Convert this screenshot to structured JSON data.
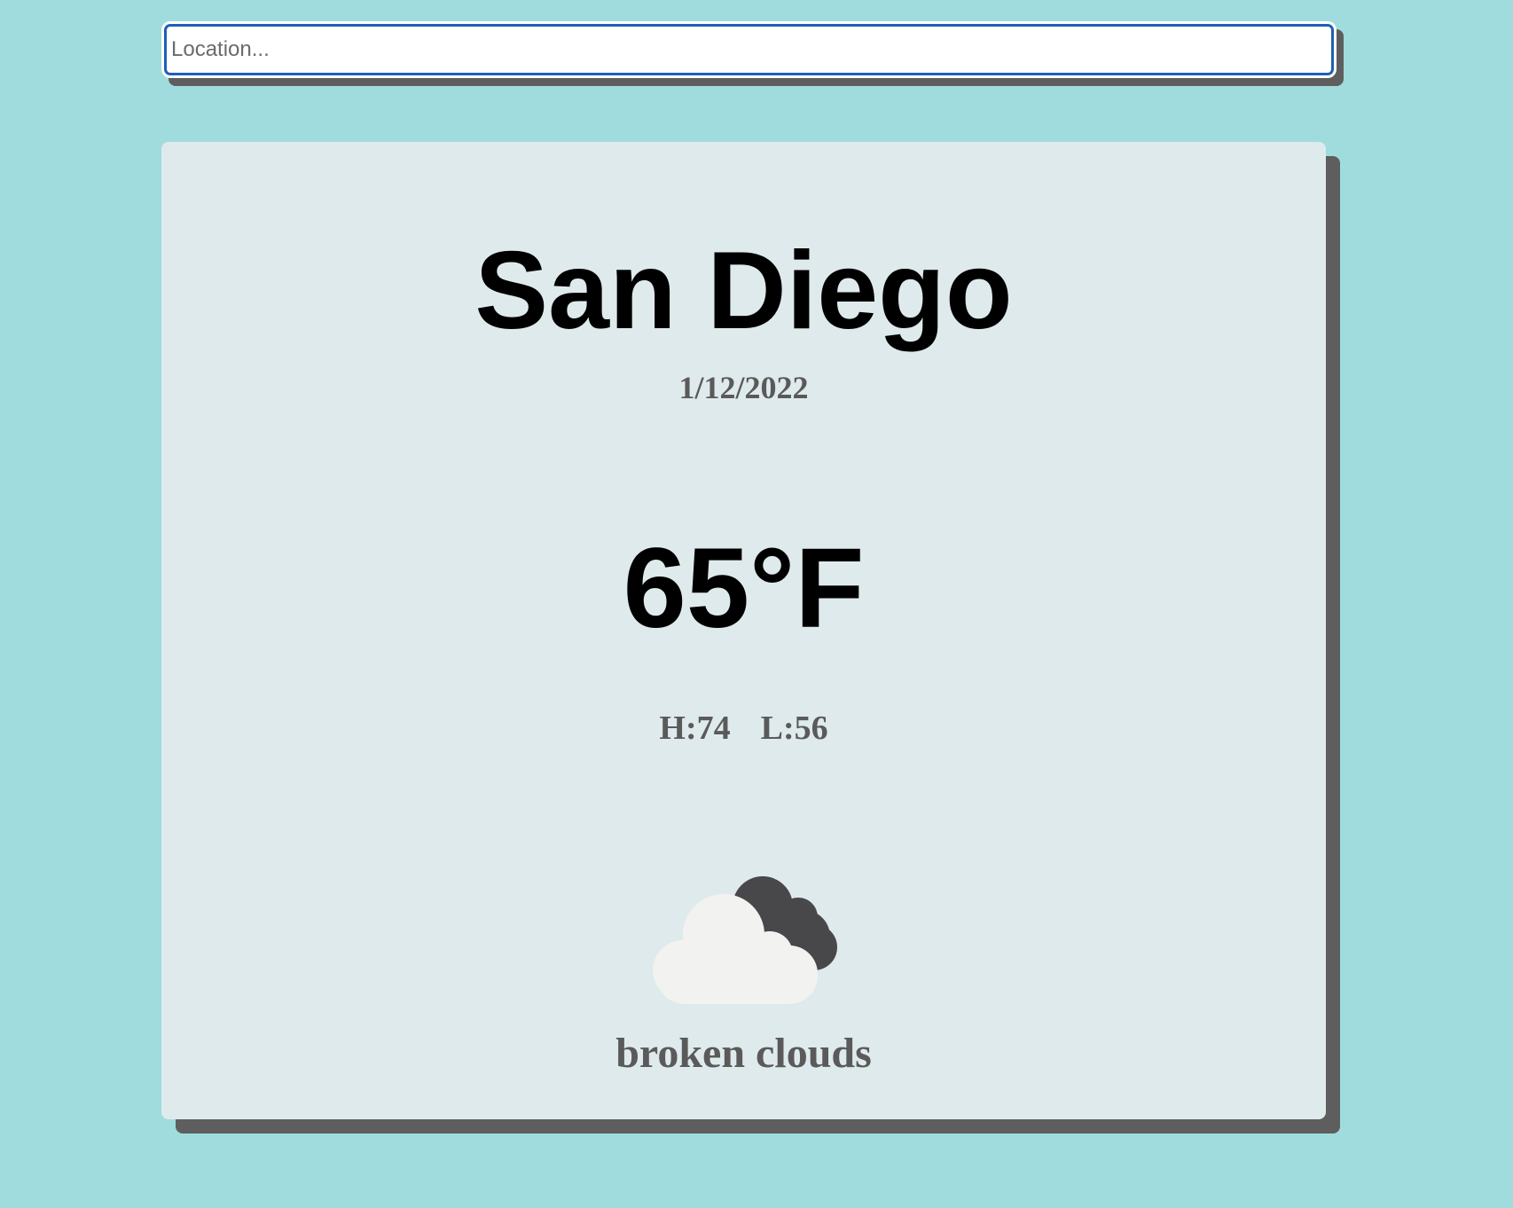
{
  "search": {
    "placeholder": "Location...",
    "value": ""
  },
  "weather": {
    "city": "San Diego",
    "date": "1/12/2022",
    "temperature": "65°F",
    "high": "H:74",
    "low": "L:56",
    "icon": "broken-clouds-icon",
    "description": "broken clouds"
  },
  "colors": {
    "background": "#a0dcdd",
    "card": "#dfeaec",
    "shadow": "#5e5e5e",
    "input_focus": "#1f5fb6"
  }
}
